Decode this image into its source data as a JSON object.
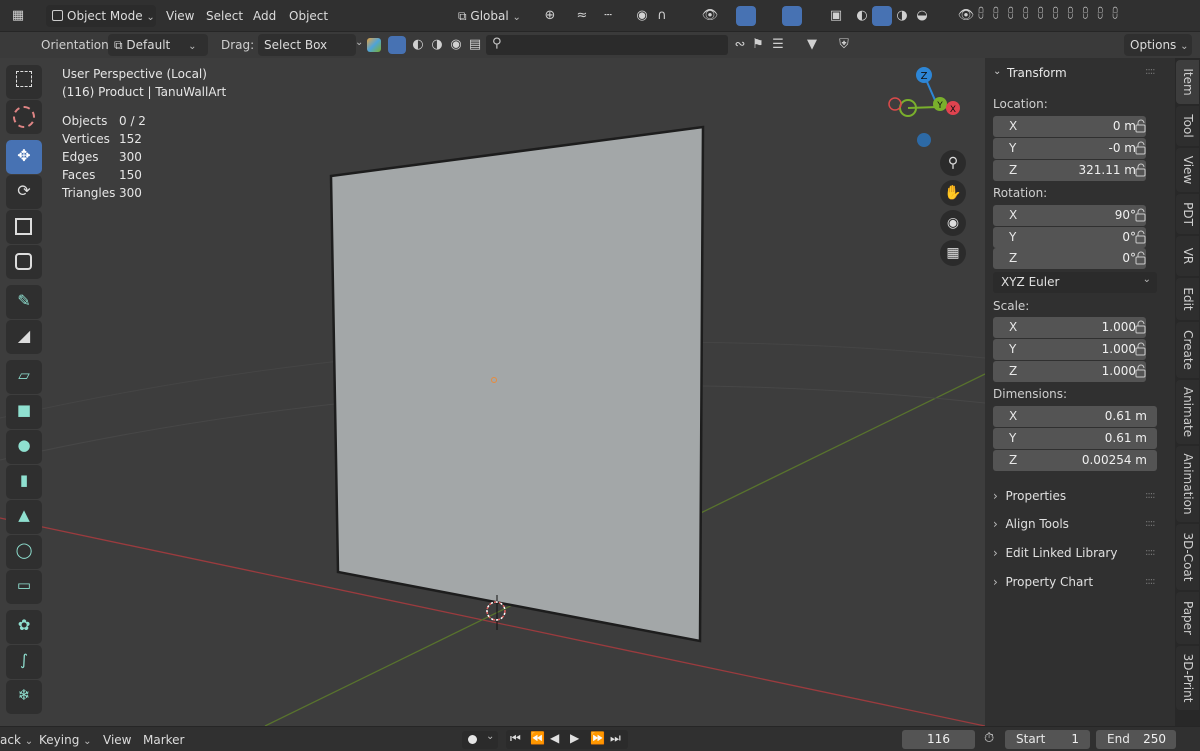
{
  "header": {
    "mode": "Object Mode",
    "menus": [
      "View",
      "Select",
      "Add",
      "Object"
    ],
    "transform_orientation": "Global",
    "options_label": "Options"
  },
  "tool_header": {
    "orientation_label": "Orientation:",
    "orientation_value": "Default",
    "drag_label": "Drag:",
    "drag_value": "Select Box",
    "search_placeholder": ""
  },
  "viewport": {
    "view_name": "User Perspective (Local)",
    "object_info": "(116) Product | TanuWallArt",
    "stats": [
      {
        "label": "Objects",
        "value": "0 / 2"
      },
      {
        "label": "Vertices",
        "value": "152"
      },
      {
        "label": "Edges",
        "value": "300"
      },
      {
        "label": "Faces",
        "value": "150"
      },
      {
        "label": "Triangles",
        "value": "300"
      }
    ],
    "gizmo": {
      "z": "Z",
      "y": "Y",
      "x": "X"
    }
  },
  "sidebar": {
    "panel_title": "Transform",
    "location_label": "Location:",
    "location": [
      {
        "axis": "X",
        "value": "0 m"
      },
      {
        "axis": "Y",
        "value": "-0 m"
      },
      {
        "axis": "Z",
        "value": "321.11 m"
      }
    ],
    "rotation_label": "Rotation:",
    "rotation": [
      {
        "axis": "X",
        "value": "90°"
      },
      {
        "axis": "Y",
        "value": "0°"
      },
      {
        "axis": "Z",
        "value": "0°"
      }
    ],
    "rotation_mode": "XYZ Euler",
    "scale_label": "Scale:",
    "scale": [
      {
        "axis": "X",
        "value": "1.000"
      },
      {
        "axis": "Y",
        "value": "1.000"
      },
      {
        "axis": "Z",
        "value": "1.000"
      }
    ],
    "dimensions_label": "Dimensions:",
    "dimensions": [
      {
        "axis": "X",
        "value": "0.61 m"
      },
      {
        "axis": "Y",
        "value": "0.61 m"
      },
      {
        "axis": "Z",
        "value": "0.00254 m"
      }
    ],
    "sections": [
      "Properties",
      "Align Tools",
      "Edit Linked Library",
      "Property Chart"
    ],
    "tabs": [
      "Item",
      "Tool",
      "View",
      "PDT",
      "VR",
      "Edit",
      "Create",
      "Animate",
      "Animation",
      "3D-Coat",
      "Paper",
      "3D-Print"
    ]
  },
  "timeline": {
    "playback": "ack",
    "keying": "Keying",
    "view": "View",
    "marker": "Marker",
    "current_frame": "116",
    "start_label": "Start",
    "start_value": "1",
    "end_label": "End",
    "end_value": "250"
  },
  "colors": {
    "accent": "#4772b3",
    "x_axis": "#e0434f",
    "y_axis": "#7ab02c",
    "z_axis": "#2d86d6",
    "plane": "#a3a7a8"
  }
}
